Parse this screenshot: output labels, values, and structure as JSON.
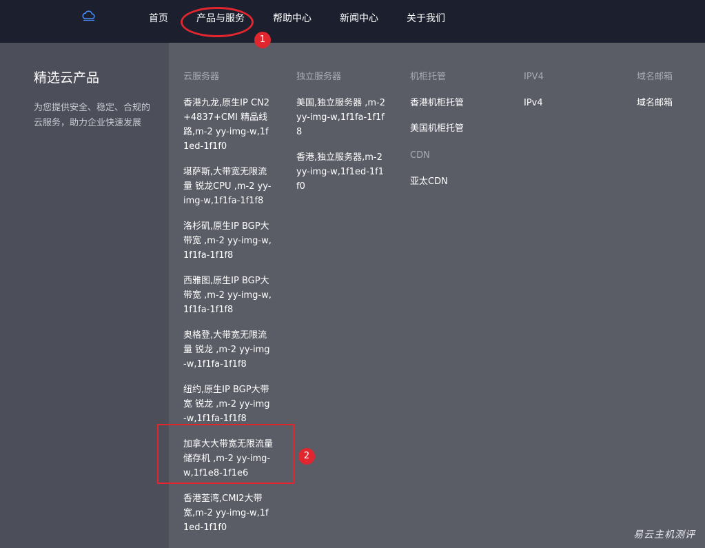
{
  "nav": {
    "items": [
      {
        "label": "首页"
      },
      {
        "label": "产品与服务"
      },
      {
        "label": "帮助中心"
      },
      {
        "label": "新闻中心"
      },
      {
        "label": "关于我们"
      }
    ]
  },
  "annotations": {
    "badge_1": "1",
    "badge_2": "2"
  },
  "sidebar": {
    "title": "精选云产品",
    "description": "为您提供安全、稳定、合规的云服务，助力企业快速发展"
  },
  "columns": {
    "cloud": {
      "heading": "云服务器",
      "links": [
        "香港九龙,原生IP CN2+4837+CMI 精品线路,m-2 yy-img-w,1f1ed-1f1f0",
        "堪萨斯,大带宽无限流量 锐龙CPU ,m-2 yy-img-w,1f1fa-1f1f8",
        "洛杉矶,原生IP BGP大带宽 ,m-2 yy-img-w,1f1fa-1f1f8",
        "西雅图,原生IP BGP大带宽 ,m-2 yy-img-w,1f1fa-1f1f8",
        "奥格登,大带宽无限流量 锐龙 ,m-2 yy-img-w,1f1fa-1f1f8",
        "纽约,原生IP BGP大带宽 锐龙 ,m-2 yy-img-w,1f1fa-1f1f8",
        "加拿大大带宽无限流量储存机 ,m-2 yy-img-w,1f1e8-1f1e6",
        "香港荃湾,CMI2大带宽,m-2 yy-img-w,1f1ed-1f1f0"
      ]
    },
    "dedicated": {
      "heading": "独立服务器",
      "links": [
        "美国,独立服务器 ,m-2 yy-img-w,1f1fa-1f1f8",
        "香港,独立服务器,m-2 yy-img-w,1f1ed-1f1f0"
      ]
    },
    "cabinet": {
      "heading": "机柜托管",
      "links": [
        "香港机柜托管",
        "美国机柜托管"
      ],
      "cdn_heading": "CDN",
      "cdn_links": [
        "亚太CDN"
      ]
    },
    "ipv4": {
      "heading": "IPV4",
      "links": [
        "IPv4"
      ]
    },
    "mail": {
      "heading": "域名邮箱",
      "links": [
        "域名邮箱"
      ]
    }
  },
  "watermark": "易云主机测评",
  "colors": {
    "topbar": "#1b1f2e",
    "panel": "#5a5c66",
    "sidebar": "#4c4e59",
    "callout": "#e0262e"
  }
}
